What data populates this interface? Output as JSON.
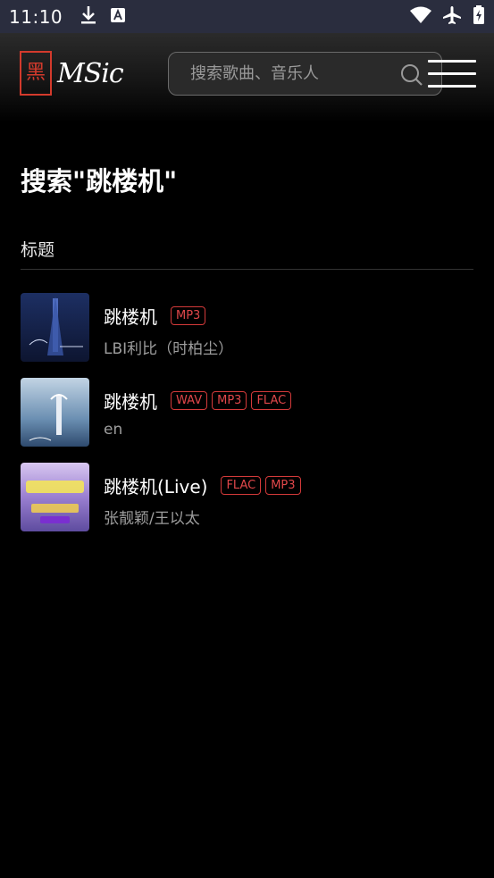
{
  "status": {
    "time": "11:10"
  },
  "header": {
    "logo_seal_text": "黑",
    "logo_text": "MSic",
    "search_placeholder": "搜索歌曲、音乐人"
  },
  "page": {
    "title": "搜索\"跳楼机\"",
    "section_label": "标题"
  },
  "songs": [
    {
      "title": "跳楼机",
      "tags": [
        "MP3"
      ],
      "artist": "LBI利比（时柏尘）"
    },
    {
      "title": "跳楼机",
      "tags": [
        "WAV",
        "MP3",
        "FLAC"
      ],
      "artist": "en"
    },
    {
      "title": "跳楼机(Live)",
      "tags": [
        "FLAC",
        "MP3"
      ],
      "artist": "张靓颖/王以太"
    }
  ],
  "colors": {
    "accent": "#d33a2c",
    "background": "#000000",
    "statusbar": "#2a2d3e"
  }
}
